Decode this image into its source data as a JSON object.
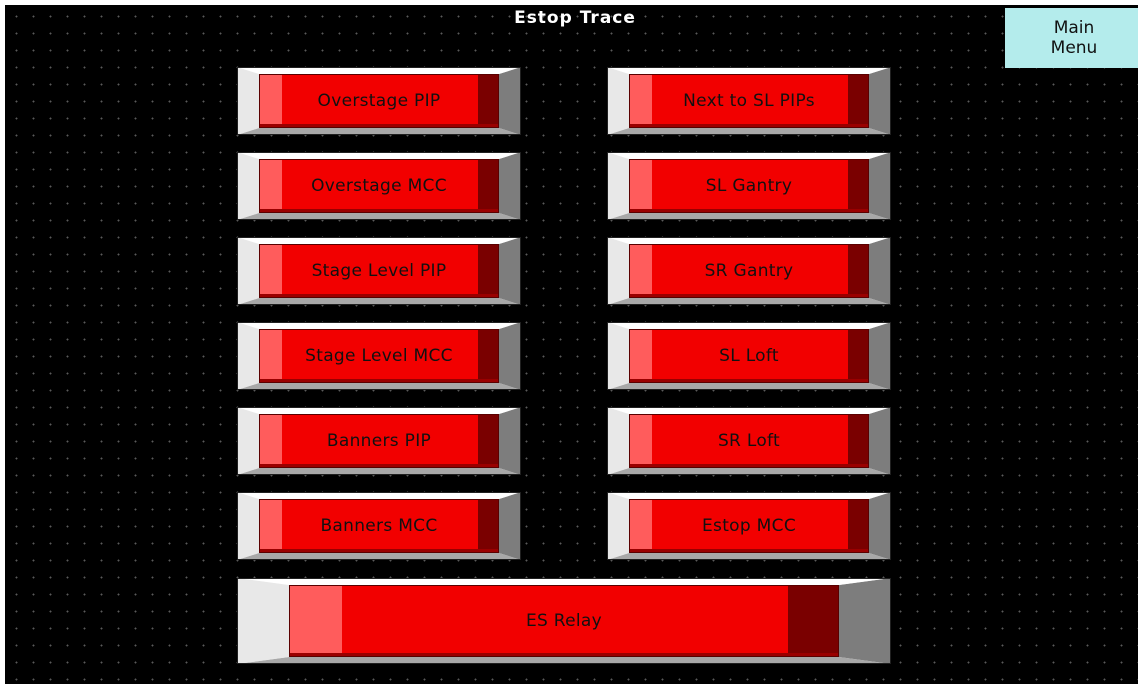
{
  "screen": {
    "title": "Estop Trace",
    "main_menu": {
      "line1": "Main",
      "line2": "Menu"
    }
  },
  "buttons": {
    "overstage_pip": "Overstage PIP",
    "overstage_mcc": "Overstage MCC",
    "stage_level_pip": "Stage Level PIP",
    "stage_level_mcc": "Stage Level MCC",
    "banners_pip": "Banners PIP",
    "banners_mcc": "Banners MCC",
    "next_to_sl_pips": "Next to SL PIPs",
    "sl_gantry": "SL Gantry",
    "sr_gantry": "SR Gantry",
    "sl_loft": "SL Loft",
    "sr_loft": "SR Loft",
    "estop_mcc": "Estop MCC",
    "es_relay": "ES Relay"
  },
  "colors": {
    "background": "#000000",
    "button_face": "#f20000",
    "menu_button": "#b4ecec"
  }
}
